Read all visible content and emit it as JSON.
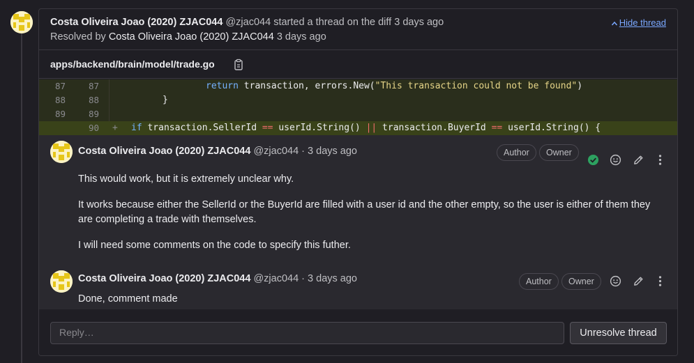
{
  "thread": {
    "author_name": "Costa Oliveira Joao (2020) ZJAC044",
    "author_handle": "@zjac044",
    "action_text": "started a thread on the diff",
    "time": "3 days ago",
    "resolved_prefix": "Resolved by",
    "resolved_by": "Costa Oliveira Joao (2020) ZJAC044",
    "resolved_time": "3 days ago",
    "hide_label": "Hide thread"
  },
  "file": {
    "path": "apps/backend/brain/model/trade.go"
  },
  "diff": {
    "rows": [
      {
        "old": "87",
        "new": "87"
      },
      {
        "old": "88",
        "new": "88"
      },
      {
        "old": "89",
        "new": "89"
      },
      {
        "old": "",
        "new": "90",
        "marker": "+"
      }
    ],
    "code1_kw": "return",
    "code1_a": " transaction, errors.New(",
    "code1_str": "\"This transaction could not be found\"",
    "code1_b": ")",
    "code2": "}",
    "code4_kw": "if",
    "code4_a": " transaction.SellerId ",
    "code4_op1": "==",
    "code4_b": " userId.String() ",
    "code4_op2": "||",
    "code4_c": " transaction.BuyerId ",
    "code4_op3": "==",
    "code4_d": " userId.String() {"
  },
  "notes": [
    {
      "author": "Costa Oliveira Joao (2020) ZJAC044",
      "meta": "@zjac044 · 3 days ago",
      "badges": [
        "Author",
        "Owner"
      ],
      "paragraphs": [
        "This would work, but it is extremely unclear why.",
        "It works because either the SellerId or the BuyerId are filled with a user id and the other empty, so the user is either of them they are completing a trade with themselves.",
        "I will need some comments on the code to specify this futher."
      ]
    },
    {
      "author": "Costa Oliveira Joao (2020) ZJAC044",
      "meta": "@zjac044 · 3 days ago",
      "badges": [
        "Author",
        "Owner"
      ],
      "paragraphs": [
        "Done, comment made"
      ]
    }
  ],
  "reply": {
    "placeholder": "Reply…",
    "unresolve_label": "Unresolve thread"
  },
  "colors": {
    "accent_link": "#7aa8ff",
    "resolved_green": "#2da160",
    "diff_added_bg": "#394219"
  }
}
